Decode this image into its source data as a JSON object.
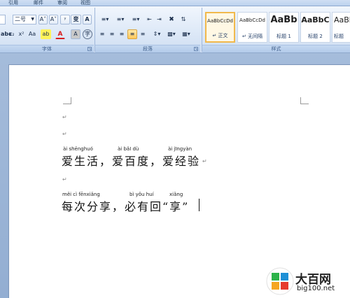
{
  "menu_tabs": [
    "引用",
    "邮件",
    "审阅",
    "视图"
  ],
  "ribbon": {
    "font_size_value": "二号",
    "font_group_label": "字体",
    "paragraph_group_label": "段落",
    "styles_group_label": "样式",
    "font_buttons": {
      "grow": "A˄",
      "shrink": "A˅",
      "clear": "ʸ",
      "phonetic": "变",
      "border_char": "A",
      "strike": "abc",
      "subscript": "x₂",
      "superscript": "x²",
      "change_case": "Aa",
      "highlight": "ab",
      "font_color": "A",
      "shade": "A",
      "enclose": "字"
    },
    "styles": [
      {
        "sample": "AaBbCcDd",
        "name": "↵ 正文",
        "active": true
      },
      {
        "sample": "AaBbCcDd",
        "name": "↵ 无间隔",
        "active": false
      },
      {
        "sample": "AaBb",
        "name": "标题 1",
        "active": false
      },
      {
        "sample": "AaBbC",
        "name": "标题 2",
        "active": false
      },
      {
        "sample": "AaBbC",
        "name": "标题",
        "active": false
      }
    ]
  },
  "document": {
    "line1_pinyin": [
      "ài shēnghuó",
      "ài bǎI dù",
      "ài jīngyàn"
    ],
    "line1_text": "爱生活，爱百度，爱经验",
    "line2_pinyin": [
      "měi cì fēnxiǎng",
      "bì yǒu huí",
      "xiǎng"
    ],
    "line2_text": "每次分享，必有回“享”",
    "para_mark": "↵"
  },
  "watermark": {
    "brand": "大百网",
    "url": "big100.net"
  }
}
